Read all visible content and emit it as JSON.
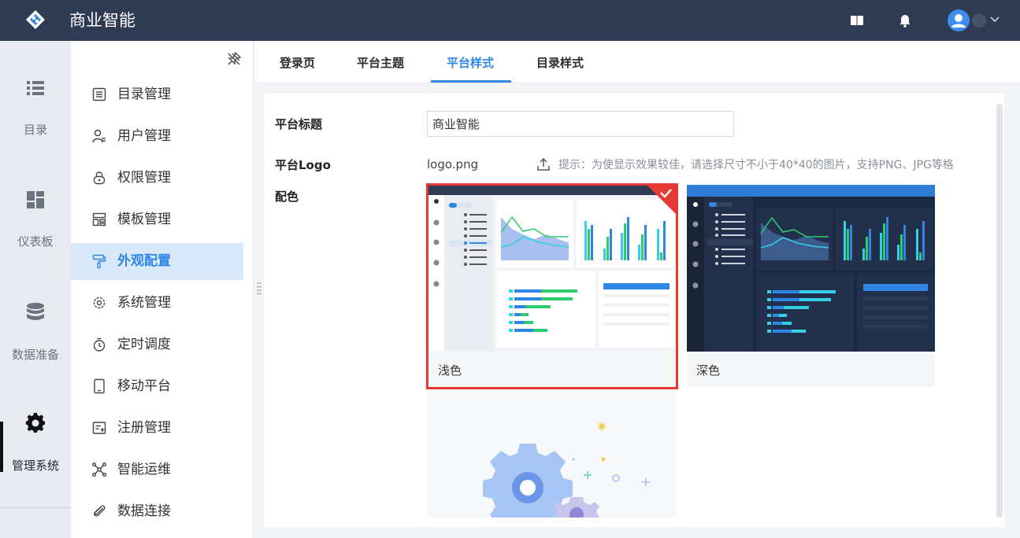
{
  "app": {
    "title": "商业智能"
  },
  "header": {
    "icons": [
      "book-icon",
      "bell-icon",
      "user-avatar-icon",
      "chevron-down-icon"
    ]
  },
  "rail": {
    "items": [
      {
        "label": "目录",
        "icon": "list-icon"
      },
      {
        "label": "仪表板",
        "icon": "dashboard-icon"
      },
      {
        "label": "数据准备",
        "icon": "database-icon"
      },
      {
        "label": "管理系统",
        "icon": "gear-icon",
        "active": true
      }
    ]
  },
  "menu": {
    "items": [
      {
        "label": "目录管理",
        "icon": "document-list-icon"
      },
      {
        "label": "用户管理",
        "icon": "user-list-icon"
      },
      {
        "label": "权限管理",
        "icon": "lock-icon"
      },
      {
        "label": "模板管理",
        "icon": "template-icon"
      },
      {
        "label": "外观配置",
        "icon": "paint-roller-icon",
        "active": true
      },
      {
        "label": "系统管理",
        "icon": "settings-icon"
      },
      {
        "label": "定时调度",
        "icon": "stopwatch-icon"
      },
      {
        "label": "移动平台",
        "icon": "tablet-icon"
      },
      {
        "label": "注册管理",
        "icon": "register-icon"
      },
      {
        "label": "智能运维",
        "icon": "network-icon"
      },
      {
        "label": "数据连接",
        "icon": "paperclip-icon"
      }
    ]
  },
  "tabs": [
    {
      "label": "登录页"
    },
    {
      "label": "平台主题"
    },
    {
      "label": "平台样式",
      "active": true
    },
    {
      "label": "目录样式"
    }
  ],
  "form": {
    "platform_title_label": "平台标题",
    "platform_title_value": "商业智能",
    "logo_label": "平台Logo",
    "logo_file": "logo.png",
    "logo_hint": "提示：为使显示效果较佳，请选择尺寸不小于40*40的图片，支持PNG、JPG等格",
    "color_label": "配色"
  },
  "themes": [
    {
      "name": "浅色",
      "selected": true
    },
    {
      "name": "深色",
      "selected": false
    }
  ],
  "colors": {
    "topbar": "#2f3b52",
    "accent": "#2f86e5",
    "selected_border": "#e53935"
  }
}
